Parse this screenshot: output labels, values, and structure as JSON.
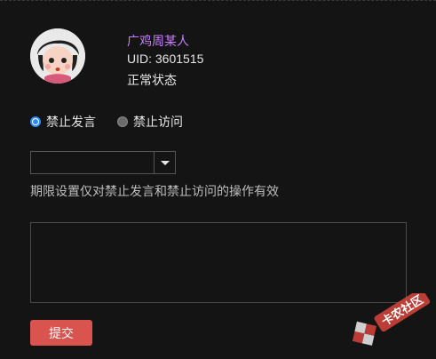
{
  "user": {
    "name": "广鸡周某人",
    "uid": "UID: 3601515",
    "status": "正常状态"
  },
  "ban_options": [
    {
      "label": "禁止发言",
      "checked": true
    },
    {
      "label": "禁止访问",
      "checked": false
    }
  ],
  "duration_select": {
    "value": ""
  },
  "hint": "期限设置仅对禁止发言和禁止访问的操作有效",
  "note_textarea": {
    "value": ""
  },
  "submit_label": "提交",
  "watermark": {
    "text": "卡农社区"
  },
  "colors": {
    "background": "#141414",
    "username": "#c77dff",
    "accent": "#2d8cf0",
    "submit": "#d9534f"
  }
}
